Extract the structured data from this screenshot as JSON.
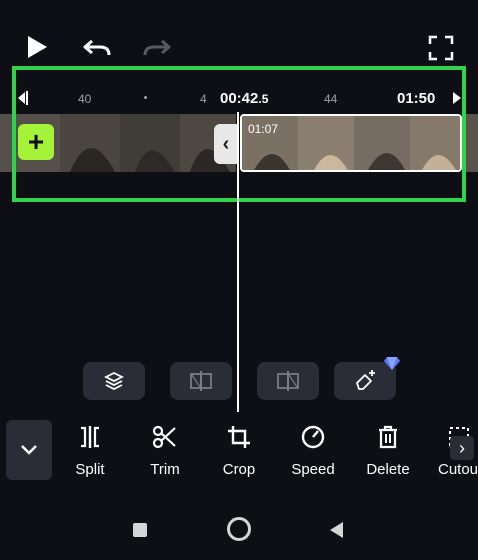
{
  "player": {
    "play_icon": "play-icon",
    "undo_icon": "undo-icon",
    "redo_icon": "redo-icon",
    "fullscreen_icon": "fullscreen-icon"
  },
  "timeline": {
    "ticks": [
      "40",
      "4",
      "44"
    ],
    "current_time": "00:42",
    "current_time_fraction": ".5",
    "total_time": "01:50",
    "clip_duration": "01:07",
    "add_button": "+",
    "collapse_arrow": "‹"
  },
  "chip_tools": [
    {
      "name": "layers-icon"
    },
    {
      "name": "split-left-icon"
    },
    {
      "name": "split-right-icon"
    },
    {
      "name": "magic-eraser-icon",
      "badge": "diamond-icon"
    }
  ],
  "toolbar": {
    "collapse_icon": "chevron-down-icon",
    "tools": [
      {
        "label": "Split",
        "icon": "split-icon"
      },
      {
        "label": "Trim",
        "icon": "scissors-icon"
      },
      {
        "label": "Crop",
        "icon": "crop-icon"
      },
      {
        "label": "Speed",
        "icon": "speed-icon"
      },
      {
        "label": "Delete",
        "icon": "trash-icon"
      },
      {
        "label": "Cutou",
        "icon": "cutout-icon"
      }
    ],
    "more_arrow": "›"
  },
  "navbar": {
    "recents": "square-icon",
    "home": "circle-icon",
    "back": "triangle-icon"
  },
  "colors": {
    "background": "#0e0f14",
    "highlight": "#2fd24a",
    "add_button": "#a4f23a",
    "chip": "#2a2d35"
  }
}
